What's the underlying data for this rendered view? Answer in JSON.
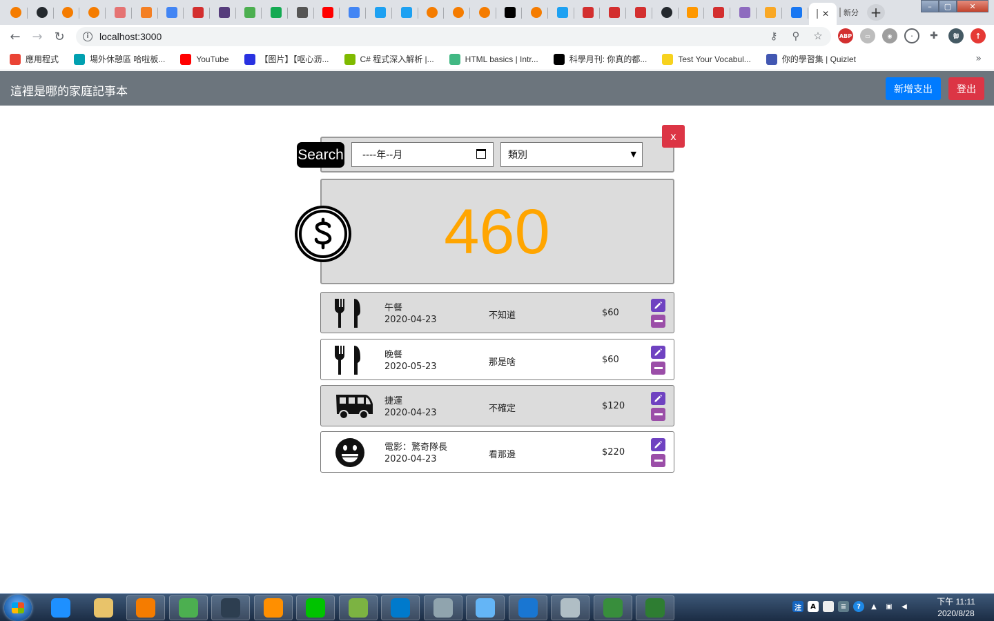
{
  "browser": {
    "tabs": [
      {
        "icon": "orange-circle-icon",
        "color": "#f57c00"
      },
      {
        "icon": "github-icon",
        "color": "#24292e"
      },
      {
        "icon": "orange-circle-icon",
        "color": "#f57c00"
      },
      {
        "icon": "orange-circle-icon",
        "color": "#f57c00"
      },
      {
        "icon": "reload-icon",
        "color": "#e57373"
      },
      {
        "icon": "stackoverflow-icon",
        "color": "#f48024"
      },
      {
        "icon": "translate-icon",
        "color": "#4285f4"
      },
      {
        "icon": "c-icon",
        "color": "#d32f2f"
      },
      {
        "icon": "bootstrap-icon",
        "color": "#563d7c"
      },
      {
        "icon": "w3-icon",
        "color": "#4caf50"
      },
      {
        "icon": "mongodb-icon",
        "color": "#13aa52"
      },
      {
        "icon": "ex-icon",
        "color": "#555555"
      },
      {
        "icon": "youtube-icon",
        "color": "#ff0000"
      },
      {
        "icon": "google-icon",
        "color": "#4285f4"
      },
      {
        "icon": "bird-icon",
        "color": "#1da1f2"
      },
      {
        "icon": "bird-icon",
        "color": "#1da1f2"
      },
      {
        "icon": "orange-circle-icon",
        "color": "#f57c00"
      },
      {
        "icon": "orange-circle-icon",
        "color": "#f57c00"
      },
      {
        "icon": "orange-circle-icon",
        "color": "#f57c00"
      },
      {
        "icon": "codepen-icon",
        "color": "#000000"
      },
      {
        "icon": "orange-circle-icon",
        "color": "#f57c00"
      },
      {
        "icon": "bird-icon",
        "color": "#1da1f2"
      },
      {
        "icon": "n-icon",
        "color": "#d32f2f"
      },
      {
        "icon": "n-icon",
        "color": "#d32f2f"
      },
      {
        "icon": "n-icon",
        "color": "#d32f2f"
      },
      {
        "icon": "github-icon",
        "color": "#24292e"
      },
      {
        "icon": "blogger-icon",
        "color": "#ff9800"
      },
      {
        "icon": "n-icon",
        "color": "#d32f2f"
      },
      {
        "icon": "h-icon",
        "color": "#8e6bbf"
      },
      {
        "icon": "bookmark-icon",
        "color": "#f9a825"
      },
      {
        "icon": "facebook-icon",
        "color": "#1877f2"
      }
    ],
    "active_tab_close": "✕",
    "partial_tab_title": "新分",
    "new_tab_label": "+",
    "url": "localhost:3000",
    "bookmarks": [
      {
        "label": "應用程式",
        "icon": "apps-icon",
        "color": "#ea4335"
      },
      {
        "label": "場外休憩區 哈啦板...",
        "icon": "bahamut-icon",
        "color": "#00a0b0"
      },
      {
        "label": "YouTube",
        "icon": "youtube-icon",
        "color": "#ff0000"
      },
      {
        "label": "【图片】【呕心沥...",
        "icon": "baidu-icon",
        "color": "#2932e1"
      },
      {
        "label": "C# 程式深入解析 |...",
        "icon": "microsoft-icon",
        "color": "#7fba00"
      },
      {
        "label": "HTML basics | Intr...",
        "icon": "vue-icon",
        "color": "#41b883"
      },
      {
        "label": "科學月刊: 你真的都...",
        "icon": "sm-icon",
        "color": "#000000"
      },
      {
        "label": "Test Your Vocabul...",
        "icon": "t-icon",
        "color": "#f7d21e"
      },
      {
        "label": "你的學習集 | Quizlet",
        "icon": "quizlet-icon",
        "color": "#4257b2"
      }
    ],
    "bookmarks_more": "»"
  },
  "app": {
    "brand": "這裡是哪的家庭記事本",
    "add_button": "新增支出",
    "logout_button": "登出",
    "search_label": "Search",
    "month_placeholder": "----年--月",
    "category_select": "類別",
    "close_button": "x",
    "total": "460",
    "accent_color": "#ffa500"
  },
  "expenses": [
    {
      "name": "午餐",
      "date": "2020-04-23",
      "note": "不知道",
      "amount": "$60",
      "icon": "fork-knife-icon",
      "shade": "grey"
    },
    {
      "name": "晚餐",
      "date": "2020-05-23",
      "note": "那是啥",
      "amount": "$60",
      "icon": "fork-knife-icon",
      "shade": "white"
    },
    {
      "name": "捷運",
      "date": "2020-04-23",
      "note": "不確定",
      "amount": "$120",
      "icon": "bus-icon",
      "shade": "grey"
    },
    {
      "name": "電影：驚奇隊長",
      "date": "2020-04-23",
      "note": "看那邊",
      "amount": "$220",
      "icon": "grin-icon",
      "shade": "white"
    }
  ],
  "taskbar": {
    "apps": [
      {
        "icon": "ie-icon",
        "color": "#1e90ff"
      },
      {
        "icon": "explorer-icon",
        "color": "#e8c36a"
      },
      {
        "icon": "media-player-icon",
        "color": "#f57c00"
      },
      {
        "icon": "chrome-icon",
        "color": "#4caf50"
      },
      {
        "icon": "nox-icon",
        "color": "#2d3e50"
      },
      {
        "icon": "keepass-icon",
        "color": "#ff8f00"
      },
      {
        "icon": "line-icon",
        "color": "#00c300"
      },
      {
        "icon": "lambda-icon",
        "color": "#7cb342"
      },
      {
        "icon": "vscode-icon",
        "color": "#007acc"
      },
      {
        "icon": "paint-icon",
        "color": "#90a4ae"
      },
      {
        "icon": "notepad-icon",
        "color": "#64b5f6"
      },
      {
        "icon": "pen-icon",
        "color": "#1976d2"
      },
      {
        "icon": "calculator-icon",
        "color": "#b0bec5"
      },
      {
        "icon": "android-icon",
        "color": "#388e3c"
      },
      {
        "icon": "photos-icon",
        "color": "#2e7d32"
      }
    ],
    "time": "下午 11:11",
    "date": "2020/8/28"
  }
}
